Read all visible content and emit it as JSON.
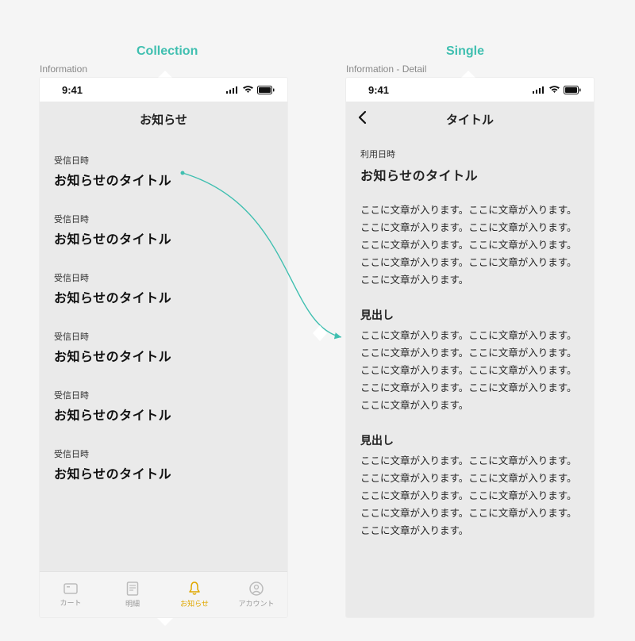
{
  "labels": {
    "collection": "Collection",
    "single": "Single",
    "info": "Information",
    "info_detail": "Information - Detail"
  },
  "status": {
    "time": "9:41"
  },
  "left": {
    "nav_title": "お知らせ",
    "items": [
      {
        "meta": "受信日時",
        "title": "お知らせのタイトル"
      },
      {
        "meta": "受信日時",
        "title": "お知らせのタイトル"
      },
      {
        "meta": "受信日時",
        "title": "お知らせのタイトル"
      },
      {
        "meta": "受信日時",
        "title": "お知らせのタイトル"
      },
      {
        "meta": "受信日時",
        "title": "お知らせのタイトル"
      },
      {
        "meta": "受信日時",
        "title": "お知らせのタイトル"
      }
    ],
    "tabs": [
      {
        "label": "カート"
      },
      {
        "label": "明細"
      },
      {
        "label": "お知らせ"
      },
      {
        "label": "アカウント"
      }
    ]
  },
  "right": {
    "nav_title": "タイトル",
    "meta": "利用日時",
    "title": "お知らせのタイトル",
    "body1": "ここに文章が入ります。ここに文章が入ります。ここに文章が入ります。ここに文章が入ります。ここに文章が入ります。ここに文章が入ります。ここに文章が入ります。ここに文章が入ります。ここに文章が入ります。",
    "heading1": "見出し",
    "body2": "ここに文章が入ります。ここに文章が入ります。ここに文章が入ります。ここに文章が入ります。ここに文章が入ります。ここに文章が入ります。ここに文章が入ります。ここに文章が入ります。ここに文章が入ります。",
    "heading2": "見出し",
    "body3": "ここに文章が入ります。ここに文章が入ります。ここに文章が入ります。ここに文章が入ります。ここに文章が入ります。ここに文章が入ります。ここに文章が入ります。ここに文章が入ります。ここに文章が入ります。"
  }
}
